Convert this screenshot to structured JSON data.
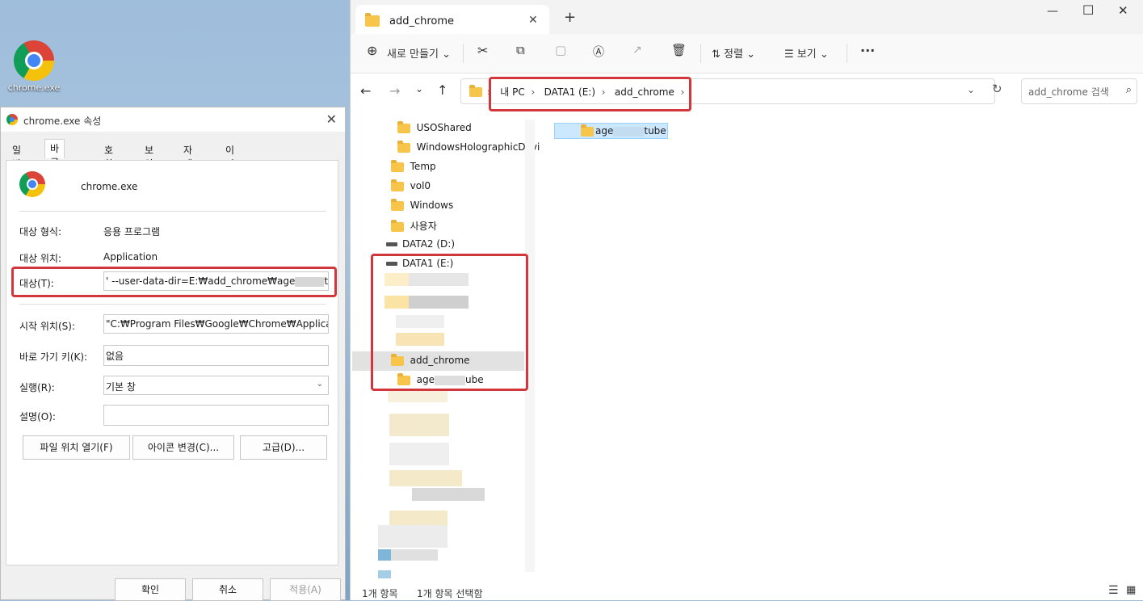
{
  "desktop": {
    "icon_label": "chrome.exe",
    "icon_name": "chrome-icon"
  },
  "properties": {
    "title": "chrome.exe 속성",
    "close": "✕",
    "tabs": [
      "일반",
      "바로 가기",
      "호환성",
      "보안",
      "자세히",
      "이전 버전"
    ],
    "active_tab": "바로 가기",
    "app_name": "chrome.exe",
    "target_type_label": "대상 형식:",
    "target_type": "응용 프로그램",
    "target_location_label": "대상 위치:",
    "target_location": "Application",
    "target_label": "대상(T):",
    "target_value": "' --user-data-dir=E:₩add_chrome₩age",
    "target_value_end": "tube",
    "start_in_label": "시작 위치(S):",
    "start_in": "\"C:₩Program Files₩Google₩Chrome₩Application\"",
    "hotkey_label": "바로 가기 키(K):",
    "hotkey": "없음",
    "run_label": "실행(R):",
    "run": "기본 창",
    "comment_label": "설명(O):",
    "comment": "",
    "buttons": {
      "open_location": "파일 위치 열기(F)",
      "change_icon": "아이콘 변경(C)...",
      "advanced": "고급(D)..."
    },
    "footer": {
      "ok": "확인",
      "cancel": "취소",
      "apply": "적용(A)"
    }
  },
  "explorer": {
    "tab_title": "add_chrome",
    "new_tab": "+",
    "window_controls": {
      "minimize": "—",
      "maximize": "☐",
      "close": "✕"
    },
    "toolbar": {
      "new": "새로 만들기",
      "sort": "정렬",
      "view": "보기",
      "more": "···"
    },
    "breadcrumb": [
      "내 PC",
      "DATA1 (E:)",
      "add_chrome"
    ],
    "search_placeholder": "add_chrome 검색",
    "tree": {
      "usoshared": "USOShared",
      "holographic": "WindowsHolographicDevi",
      "temp": "Temp",
      "vol0": "vol0",
      "windows": "Windows",
      "users": "사용자",
      "data2": "DATA2 (D:)",
      "data1": "DATA1 (E:)",
      "add_chrome": "add_chrome",
      "age_prefix": "age",
      "age_suffix": "ube"
    },
    "content_item": {
      "prefix": "age",
      "suffix": "tube"
    },
    "status": {
      "count": "1개 항목",
      "selected": "1개 항목 선택함"
    }
  },
  "colors": {
    "highlight_red": "#d2373d",
    "folder_yellow": "#f6c54a",
    "selection_blue": "#cce8ff"
  }
}
